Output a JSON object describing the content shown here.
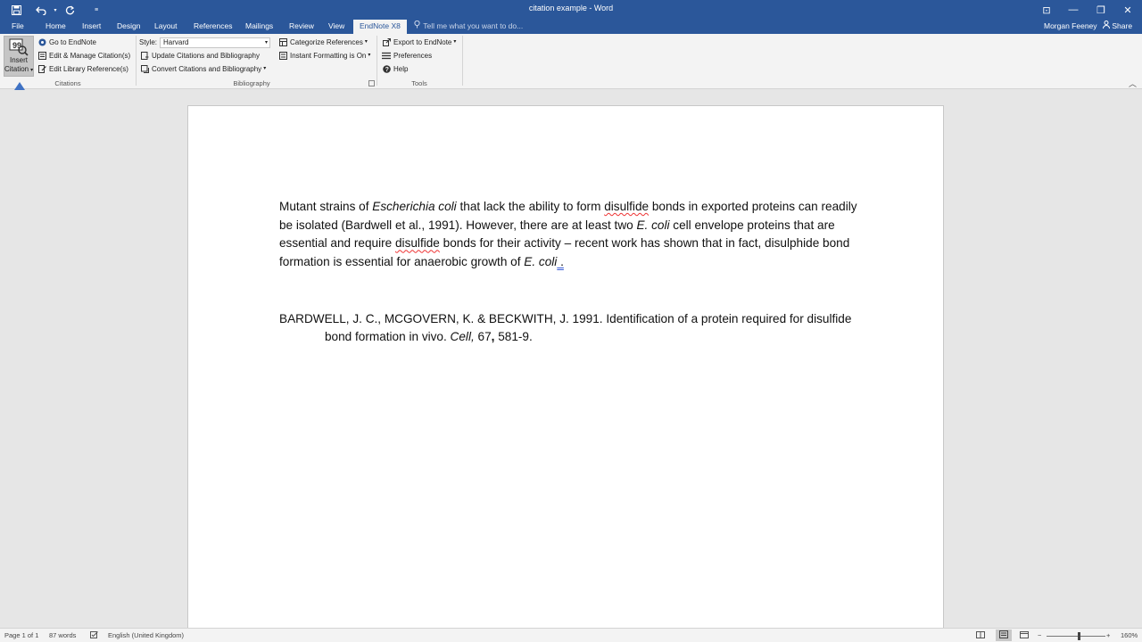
{
  "titlebar": {
    "title": "citation example - Word",
    "save_icon": "save-icon",
    "undo_icon": "undo-icon",
    "redo_icon": "repeat-icon",
    "customize_icon": "customize-icon",
    "ribbon_display_glyph": "⊡",
    "minimize_glyph": "—",
    "restore_glyph": "❐",
    "close_glyph": "✕"
  },
  "tabs": [
    "File",
    "Home",
    "Insert",
    "Design",
    "Layout",
    "References",
    "Mailings",
    "Review",
    "View",
    "EndNote X8"
  ],
  "active_tab": "EndNote X8",
  "tell_me": "Tell me what you want to do...",
  "user": "Morgan Feeney",
  "share": "Share",
  "ribbon": {
    "citations": {
      "insert_citation_line1": "Insert",
      "insert_citation_line2": "Citation",
      "go_to_endnote": "Go to EndNote",
      "edit_manage": "Edit & Manage Citation(s)",
      "edit_library": "Edit Library Reference(s)",
      "label": "Citations"
    },
    "bibliography": {
      "style_label": "Style:",
      "style_value": "Harvard",
      "update": "Update Citations and Bibliography",
      "convert": "Convert Citations and Bibliography",
      "categorize": "Categorize References",
      "instant": "Instant Formatting is On",
      "label": "Bibliography"
    },
    "tools": {
      "export": "Export to EndNote",
      "preferences": "Preferences",
      "help": "Help",
      "label": "Tools"
    }
  },
  "document": {
    "p1_a": "Mutant strains of ",
    "p1_b": "Escherichia coli",
    "p1_c": " that lack the ability to form ",
    "p1_d": "disulfide",
    "p1_e": " bonds in exported proteins can readily be isolated (Bardwell et al., 1991). However, there are at least two ",
    "p1_f": "E. coli",
    "p1_g": " cell envelope proteins that are essential and require ",
    "p1_h": "disulfide",
    "p1_i": " bonds for their activity – recent work has shown that in fact, disulphide bond formation is essential for anaerobic growth of ",
    "p1_j": "E. coli",
    "p1_k": " .",
    "ref_a": "BARDWELL, J. C., MCGOVERN, K. & BECKWITH, J. 1991. Identification of a protein required for disulfide bond formation in vivo. ",
    "ref_b": "Cell,",
    "ref_c": " 67",
    "ref_d": ",",
    "ref_e": " 581-9."
  },
  "status": {
    "page": "Page 1 of 1",
    "words": "87 words",
    "language": "English (United Kingdom)",
    "zoom": "160%",
    "zoom_minus": "−",
    "zoom_plus": "+"
  },
  "colors": {
    "word_blue": "#2b579a",
    "annotation_arrow": "#3f72c4"
  }
}
